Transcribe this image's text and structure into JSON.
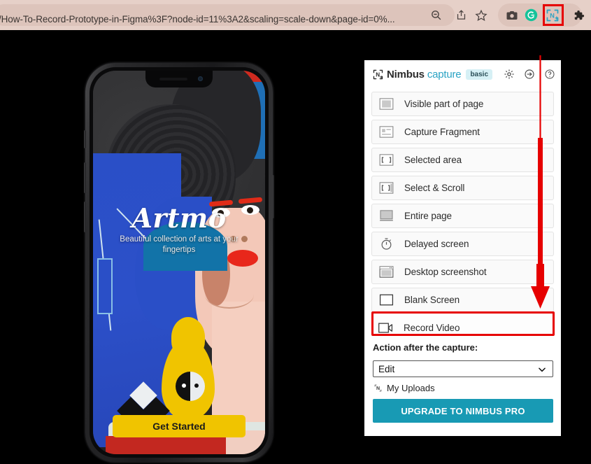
{
  "browser": {
    "url_text": "/How-To-Record-Prototype-in-Figma%3F?node-id=11%3A2&scaling=scale-down&page-id=0%...",
    "toolbar_icons": [
      {
        "name": "zoom-out-icon",
        "glyph": "search-minus"
      },
      {
        "name": "share-icon",
        "glyph": "share"
      },
      {
        "name": "bookmark-star-icon",
        "glyph": "star"
      },
      {
        "name": "camera-extension-icon",
        "glyph": "camera"
      },
      {
        "name": "grammarly-extension-icon",
        "glyph": "G"
      },
      {
        "name": "nimbus-extension-icon",
        "glyph": "N+"
      },
      {
        "name": "extensions-puzzle-icon",
        "glyph": "puzzle"
      }
    ],
    "highlight_color": "#e60000"
  },
  "phone_app": {
    "title": "Artmo",
    "subtitle": "Beautiful collection of arts  at your fingertips",
    "cta_label": "Get Started",
    "cta_color": "#f0c400"
  },
  "panel": {
    "brand_primary": "Nimbus",
    "brand_secondary": "capture",
    "plan_badge": "basic",
    "accent_color": "#2aa3c4",
    "header_icons": [
      {
        "name": "settings-gear-icon",
        "label": "Settings"
      },
      {
        "name": "sign-in-icon",
        "label": "Sign in"
      },
      {
        "name": "help-question-icon",
        "label": "Help"
      }
    ],
    "menu_items": [
      {
        "label": "Visible part of page",
        "icon": "visible-part-icon",
        "highlighted": false
      },
      {
        "label": "Capture Fragment",
        "icon": "fragment-icon",
        "highlighted": false
      },
      {
        "label": "Selected area",
        "icon": "selected-area-icon",
        "highlighted": false
      },
      {
        "label": "Select & Scroll",
        "icon": "select-scroll-icon",
        "highlighted": false
      },
      {
        "label": "Entire page",
        "icon": "entire-page-icon",
        "highlighted": false
      },
      {
        "label": "Delayed screen",
        "icon": "timer-icon",
        "highlighted": false
      },
      {
        "label": "Desktop screenshot",
        "icon": "desktop-icon",
        "highlighted": false
      },
      {
        "label": "Blank Screen",
        "icon": "blank-screen-icon",
        "highlighted": false
      },
      {
        "label": "Record Video",
        "icon": "video-camera-icon",
        "highlighted": true
      }
    ],
    "action_label": "Action after the capture:",
    "action_value": "Edit",
    "action_options": [
      "Edit"
    ],
    "uploads_label": "My Uploads",
    "upgrade_label": "UPGRADE TO NIMBUS PRO",
    "upgrade_color": "#189ab4"
  }
}
